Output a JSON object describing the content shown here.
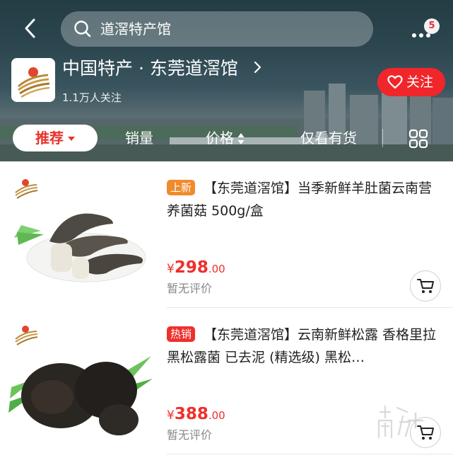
{
  "header": {
    "search_text": "道滘特产馆",
    "more_badge": "5",
    "shop_name": "中国特产 · 东莞道滘馆",
    "followers": "1.1万人关注",
    "follow_label": "关注"
  },
  "tabs": {
    "recommend": "推荐",
    "sales": "销量",
    "price": "价格",
    "in_stock": "仅看有货"
  },
  "products": [
    {
      "tag": "上新",
      "title": "【东莞道滘馆】当季新鲜羊肚菌云南营养菌菇 500g/盒",
      "currency": "¥",
      "price_int": "298",
      "price_dec": ".00",
      "review": "暂无评价",
      "image": "morel-mushrooms"
    },
    {
      "tag": "热销",
      "title": "【东莞道滘馆】云南新鲜松露 香格里拉黑松露菌 已去泥 (精选级) 黑松…",
      "currency": "¥",
      "price_int": "388",
      "price_dec": ".00",
      "review": "暂无评价",
      "image": "black-truffles"
    }
  ],
  "watermark": "南方+",
  "colors": {
    "accent_red": "#ef2f2c",
    "tag_new": "#f08a2c",
    "tag_hot": "#ef2f2c"
  }
}
